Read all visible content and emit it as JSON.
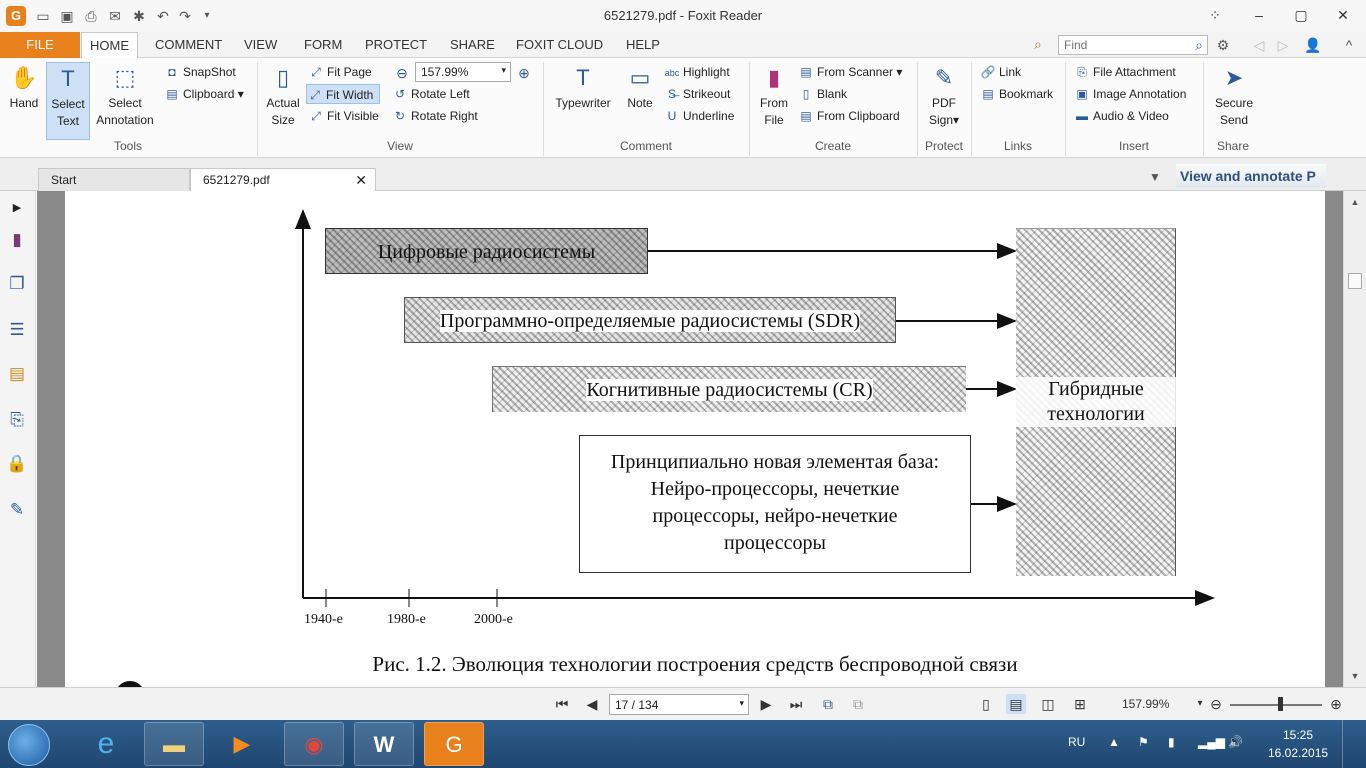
{
  "window": {
    "title": "6521279.pdf - Foxit Reader",
    "app_icon": "foxit-logo-icon"
  },
  "quick_access": [
    "folder-open-icon",
    "save-icon",
    "print-icon",
    "email-icon",
    "new-icon",
    "undo-icon",
    "redo-icon",
    "customize-dropdown-icon"
  ],
  "menu": {
    "file": "FILE",
    "tabs": [
      "HOME",
      "COMMENT",
      "VIEW",
      "FORM",
      "PROTECT",
      "SHARE",
      "FOXIT CLOUD",
      "HELP"
    ],
    "active": "HOME",
    "find_placeholder": "Find"
  },
  "ribbon": {
    "tools": {
      "label": "Tools",
      "hand": "Hand",
      "select_text_1": "Select",
      "select_text_2": "Text",
      "select_annotation_1": "Select",
      "select_annotation_2": "Annotation",
      "snapshot": "SnapShot",
      "clipboard": "Clipboard"
    },
    "view": {
      "label": "View",
      "actual_size_1": "Actual",
      "actual_size_2": "Size",
      "fit_page": "Fit Page",
      "fit_width": "Fit Width",
      "fit_visible": "Fit Visible",
      "zoom": "157.99%",
      "rotate_left": "Rotate Left",
      "rotate_right": "Rotate Right"
    },
    "comment": {
      "label": "Comment",
      "typewriter": "Typewriter",
      "note": "Note",
      "highlight": "Highlight",
      "strikeout": "Strikeout",
      "underline": "Underline"
    },
    "create": {
      "label": "Create",
      "from_file_1": "From",
      "from_file_2": "File",
      "from_scanner": "From Scanner",
      "blank": "Blank",
      "from_clipboard": "From Clipboard"
    },
    "protect": {
      "label": "Protect",
      "pdf_sign_1": "PDF",
      "pdf_sign_2": "Sign"
    },
    "links": {
      "label": "Links",
      "link": "Link",
      "bookmark": "Bookmark"
    },
    "insert": {
      "label": "Insert",
      "file_attachment": "File Attachment",
      "image_annotation": "Image Annotation",
      "audio_video": "Audio & Video"
    },
    "share": {
      "label": "Share",
      "secure_send_1": "Secure",
      "secure_send_2": "Send"
    }
  },
  "doc_tabs": {
    "start": "Start",
    "file": "6521279.pdf",
    "promo": "View and annotate P"
  },
  "figure": {
    "box1": "Цифровые радиосистемы",
    "box2": "Программно-определяемые радиосистемы (SDR)",
    "box3": "Когнитивные радиосистемы (CR)",
    "box4_l1": "Принципиально новая элементая база:",
    "box4_l2": "Нейро-процессоры, нечеткие",
    "box4_l3": "процессоры, нейро-нечеткие",
    "box4_l4": "процессоры",
    "hybrid_l1": "Гибридные",
    "hybrid_l2": "технологии",
    "ticks": [
      "1940-е",
      "1980-е",
      "2000-е"
    ],
    "caption": "Рис. 1.2. Эволюция технологии построения средств беспроводной связи"
  },
  "status": {
    "page": "17 / 134",
    "zoom": "157.99%"
  },
  "taskbar": {
    "apps": [
      "windows-explorer-icon",
      "internet-explorer-icon",
      "media-player-icon",
      "chrome-icon",
      "word-icon",
      "foxit-pdf-icon"
    ],
    "lang": "RU",
    "time": "15:25",
    "date": "16.02.2015"
  }
}
